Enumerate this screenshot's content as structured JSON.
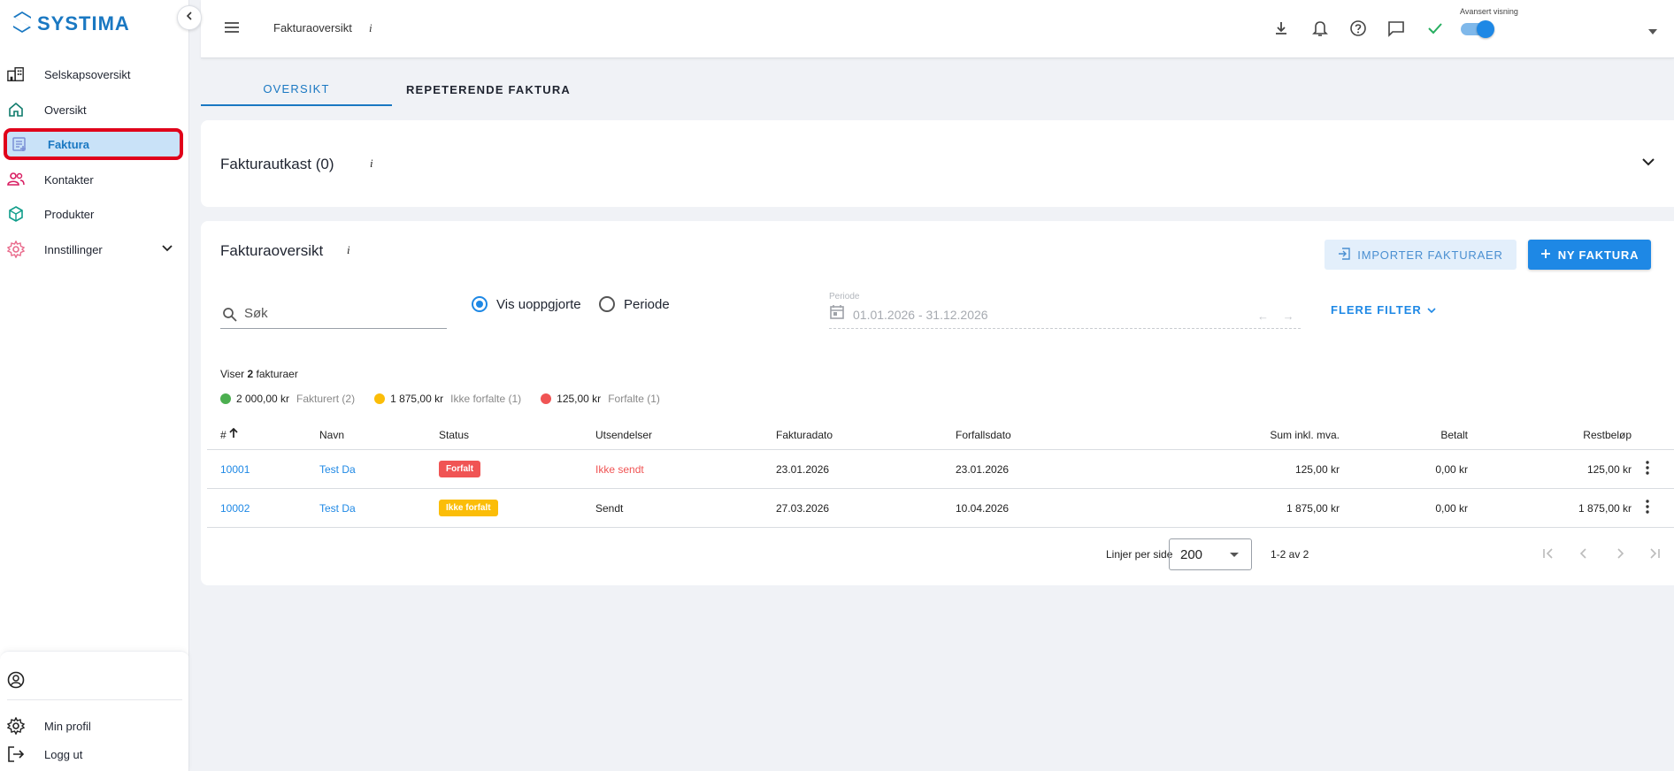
{
  "app": {
    "logo_text": "SYSTIMA",
    "accent_color": "#1e88e5"
  },
  "sidebar": {
    "items": [
      {
        "label": "Selskapsoversikt",
        "icon": "buildings-icon"
      },
      {
        "label": "Oversikt",
        "icon": "home-icon"
      },
      {
        "label": "Faktura",
        "icon": "invoice-icon",
        "active": true
      },
      {
        "label": "Kontakter",
        "icon": "contacts-icon"
      },
      {
        "label": "Produkter",
        "icon": "box-icon"
      },
      {
        "label": "Innstillinger",
        "icon": "settings-gear-icon"
      }
    ],
    "bottom": [
      {
        "label": "",
        "icon": "user-circle-icon"
      },
      {
        "label": "Min profil",
        "icon": "gear-icon"
      },
      {
        "label": "Logg ut",
        "icon": "logout-icon"
      }
    ]
  },
  "topbar": {
    "title": "Fakturaoversikt",
    "info": "i",
    "toggle_label": "Avansert visning",
    "toggle_on": true
  },
  "tabs": [
    {
      "label": "OVERSIKT",
      "active": true
    },
    {
      "label": "REPETERENDE FAKTURA"
    }
  ],
  "drafts": {
    "title": "Fakturautkast (0)",
    "info": "i"
  },
  "overview": {
    "title": "Fakturaoversikt",
    "info": "i",
    "import_label": "IMPORTER FAKTURAER",
    "new_label": "NY FAKTURA",
    "search_placeholder": "Søk",
    "radio_unsettled": "Vis uoppgjorte",
    "radio_period": "Periode",
    "period_label": "Periode",
    "period_value": "01.01.2026 - 31.12.2026",
    "period_arrows": "← →",
    "more_filters": "FLERE FILTER",
    "count_prefix": "Viser ",
    "count": "2",
    "count_suffix": " fakturaer",
    "totals": [
      {
        "amount": "2 000,00 kr",
        "label": "Fakturert (2)",
        "color": "#4caf50"
      },
      {
        "amount": "1 875,00 kr",
        "label": "Ikke forfalte (1)",
        "color": "#fbbd08"
      },
      {
        "amount": "125,00 kr",
        "label": "Forfalte (1)",
        "color": "#f05454"
      }
    ]
  },
  "table": {
    "headers": {
      "num": "#",
      "name": "Navn",
      "status": "Status",
      "send": "Utsendelser",
      "fdate": "Fakturadato",
      "due": "Forfallsdato",
      "sum": "Sum inkl. mva.",
      "paid": "Betalt",
      "rest": "Restbeløp"
    },
    "rows": [
      {
        "num": "10001",
        "name": "Test Da",
        "status": "Forfalt",
        "status_color": "red",
        "send": "Ikke sendt",
        "fdate": "23.01.2026",
        "due": "23.01.2026",
        "sum": "125,00 kr",
        "paid": "0,00 kr",
        "rest": "125,00 kr"
      },
      {
        "num": "10002",
        "name": "Test Da",
        "status": "Ikke forfalt",
        "status_color": "yellow",
        "send": "Sendt",
        "fdate": "27.03.2026",
        "due": "10.04.2026",
        "sum": "1 875,00 kr",
        "paid": "0,00 kr",
        "rest": "1 875,00 kr"
      }
    ]
  },
  "pagination": {
    "rows_label": "Linjer per side",
    "rows_value": "200",
    "page_info": "1-2 av 2"
  }
}
